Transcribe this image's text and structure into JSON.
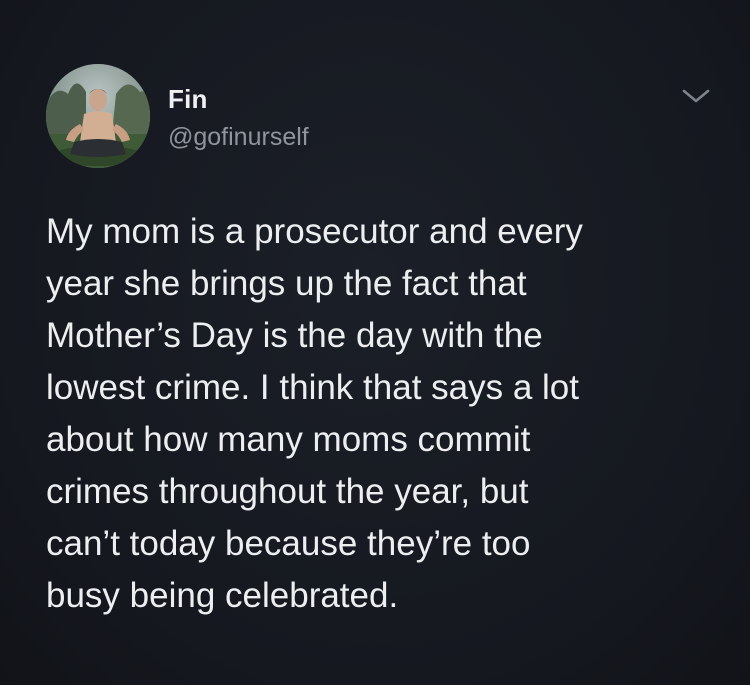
{
  "tweet": {
    "author": {
      "display_name": "Fin",
      "handle": "@gofinurself",
      "avatar_icon": "profile-photo"
    },
    "menu_icon": "chevron-down-icon",
    "text_lines": [
      "My mom is a prosecutor and every",
      "year she brings up the fact that",
      "Mother’s Day is the day with the",
      "lowest crime. I think that says a lot",
      "about how many moms commit",
      "crimes throughout the year, but",
      "can’t today because they’re too",
      "busy being celebrated."
    ]
  },
  "colors": {
    "background": "#15181f",
    "text": "#eceef0",
    "handle": "#8f959c"
  }
}
